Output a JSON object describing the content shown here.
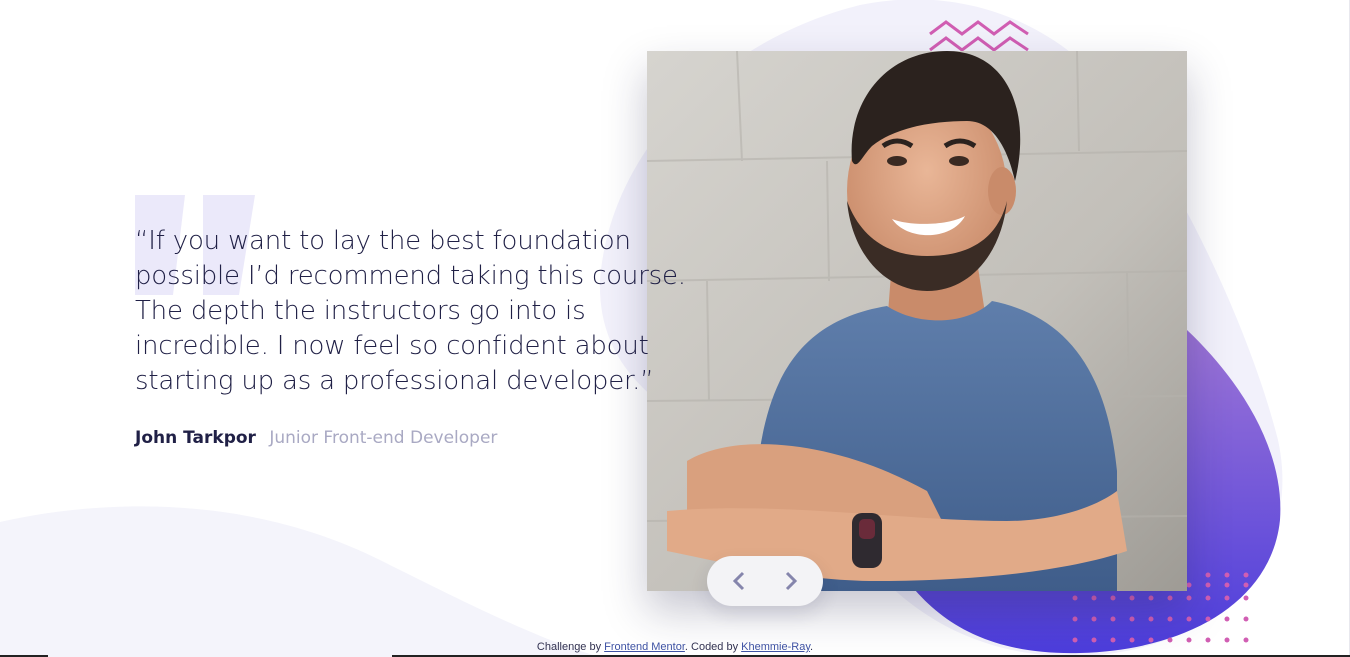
{
  "testimonial": {
    "quote": "“If you want to lay the best foundation possible I’d recommend taking this course. The depth the instructors go into is incredible. I now feel so confident about starting up as a professional developer.”",
    "name": "John Tarkpor",
    "role": "Junior Front-end Developer"
  },
  "slider": {
    "prev_icon": "chevron-left-icon",
    "next_icon": "chevron-right-icon"
  },
  "footer": {
    "prefix": "Challenge by ",
    "link1": "Frontend Mentor",
    "middle": ". Coded by ",
    "link2": "Khemmie-Ray",
    "suffix": "."
  },
  "colors": {
    "text_dark": "#202046",
    "text_muted": "#a9a9c3",
    "accent_purple": "#6b56e0",
    "accent_pink": "#d15eb3"
  }
}
